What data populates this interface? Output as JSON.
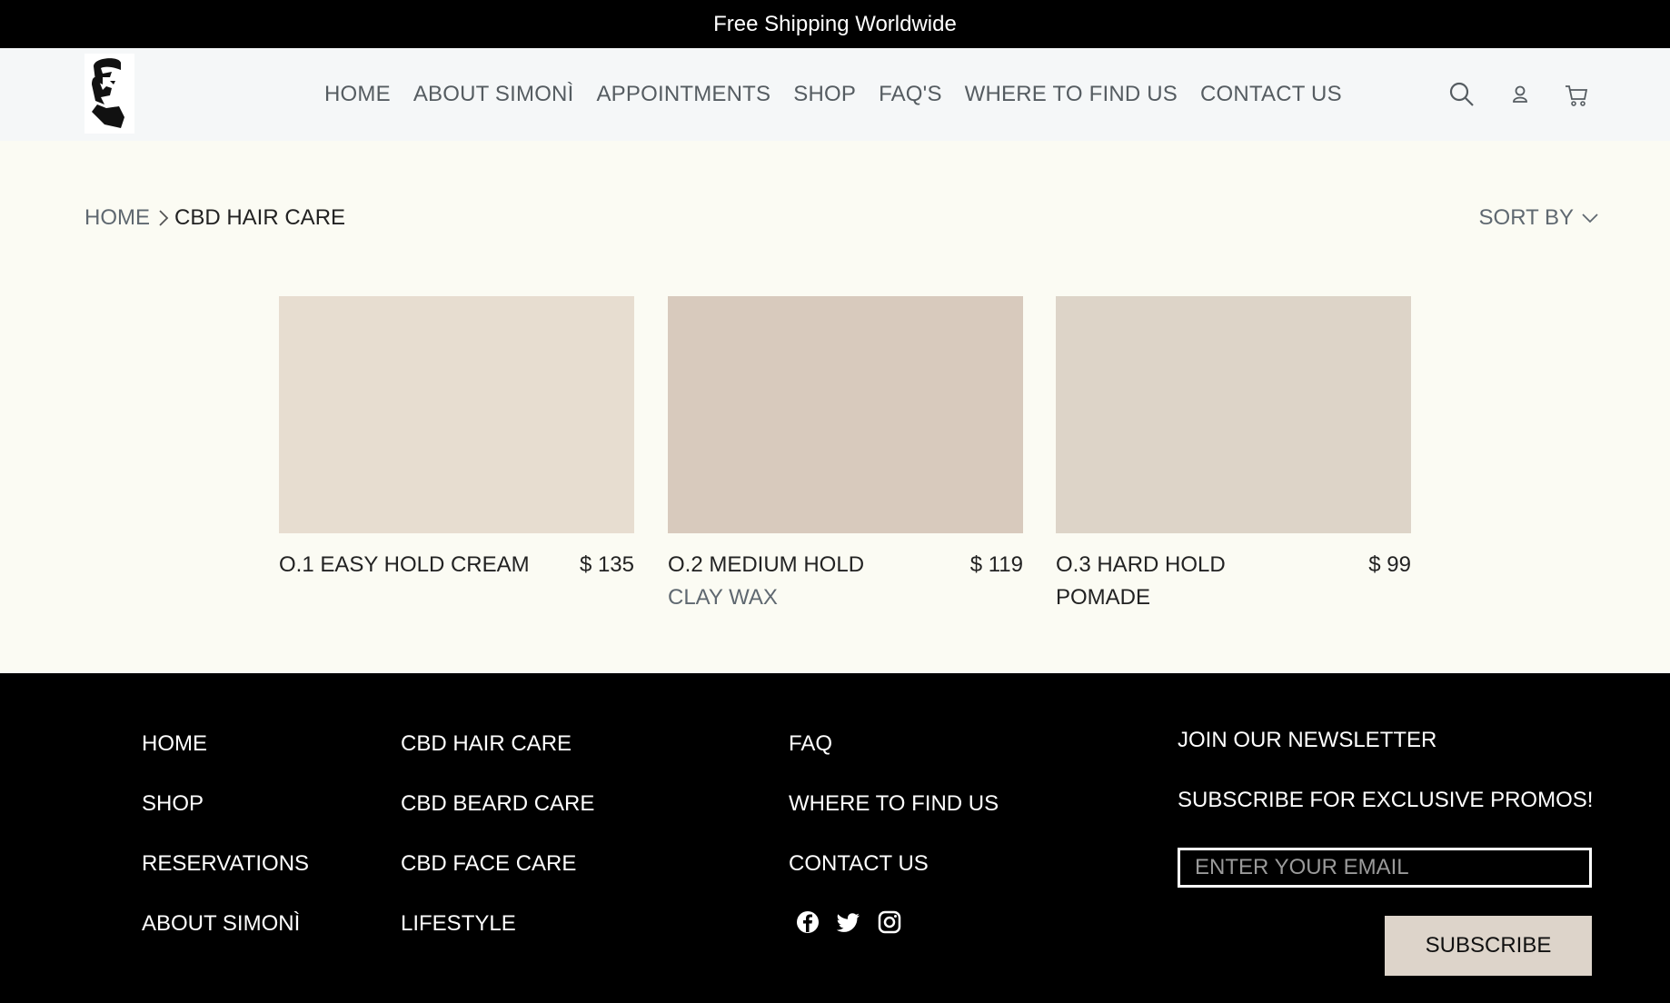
{
  "announcement": "Free Shipping Worldwide",
  "nav": {
    "items": [
      "HOME",
      "ABOUT SIMONÌ",
      "APPOINTMENTS",
      "SHOP",
      "FAQ'S",
      "WHERE TO FIND US",
      "CONTACT US"
    ]
  },
  "header_icons": [
    "search-icon",
    "account-icon",
    "cart-icon"
  ],
  "breadcrumb": {
    "home": "HOME",
    "current": "CBD HAIR CARE"
  },
  "sort_label": "SORT BY",
  "products": [
    {
      "name": "O.1 EASY HOLD CREAM",
      "sub": "",
      "price": "$ 135",
      "color": "#e7ddd0"
    },
    {
      "name": "O.2 MEDIUM HOLD",
      "sub": "CLAY WAX",
      "price": "$ 119",
      "color": "#d8cabd"
    },
    {
      "name": "O.3 HARD HOLD POMADE",
      "sub": "",
      "price": "$ 99",
      "color": "#ddd4c8"
    }
  ],
  "footer": {
    "col1": [
      "HOME",
      "SHOP",
      "RESERVATIONS",
      "ABOUT SIMONÌ"
    ],
    "col2": [
      "CBD HAIR CARE",
      "CBD BEARD CARE",
      "CBD FACE CARE",
      "LIFESTYLE"
    ],
    "col3": [
      "FAQ",
      "WHERE TO FIND US",
      "CONTACT US"
    ],
    "social": [
      "facebook-icon",
      "twitter-icon",
      "instagram-icon"
    ],
    "newsletter_title": "JOIN OUR NEWSLETTER",
    "newsletter_sub": "SUBSCRIBE FOR EXCLUSIVE PROMOS!",
    "email_placeholder": "ENTER YOUR EMAIL",
    "subscribe_label": "SUBSCRIBE"
  },
  "colors": {
    "announce_bg": "#000000",
    "header_bg": "#f5f7f8",
    "page_bg": "#fbfbf3",
    "button_bg": "#ddd4ca"
  }
}
